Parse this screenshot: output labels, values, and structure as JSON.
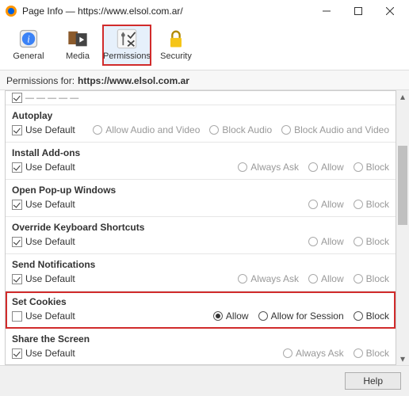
{
  "window": {
    "title": "Page Info — https://www.elsol.com.ar/"
  },
  "toolbar": {
    "general": "General",
    "media": "Media",
    "permissions": "Permissions",
    "security": "Security"
  },
  "subheader": {
    "label": "Permissions for:",
    "url": "https://www.elsol.com.ar"
  },
  "use_default_label": "Use Default",
  "rows": {
    "autoplay": {
      "title": "Autoplay",
      "opts": {
        "a": "Allow Audio and Video",
        "b": "Block Audio",
        "c": "Block Audio and Video"
      }
    },
    "addons": {
      "title": "Install Add-ons",
      "opts": {
        "a": "Always Ask",
        "b": "Allow",
        "c": "Block"
      }
    },
    "popup": {
      "title": "Open Pop-up Windows",
      "opts": {
        "b": "Allow",
        "c": "Block"
      }
    },
    "kbd": {
      "title": "Override Keyboard Shortcuts",
      "opts": {
        "b": "Allow",
        "c": "Block"
      }
    },
    "notif": {
      "title": "Send Notifications",
      "opts": {
        "a": "Always Ask",
        "b": "Allow",
        "c": "Block"
      }
    },
    "cookies": {
      "title": "Set Cookies",
      "opts": {
        "a": "Allow",
        "b": "Allow for Session",
        "c": "Block"
      }
    },
    "screen": {
      "title": "Share the Screen",
      "opts": {
        "a": "Always Ask",
        "c": "Block"
      }
    }
  },
  "footer": {
    "help": "Help"
  }
}
